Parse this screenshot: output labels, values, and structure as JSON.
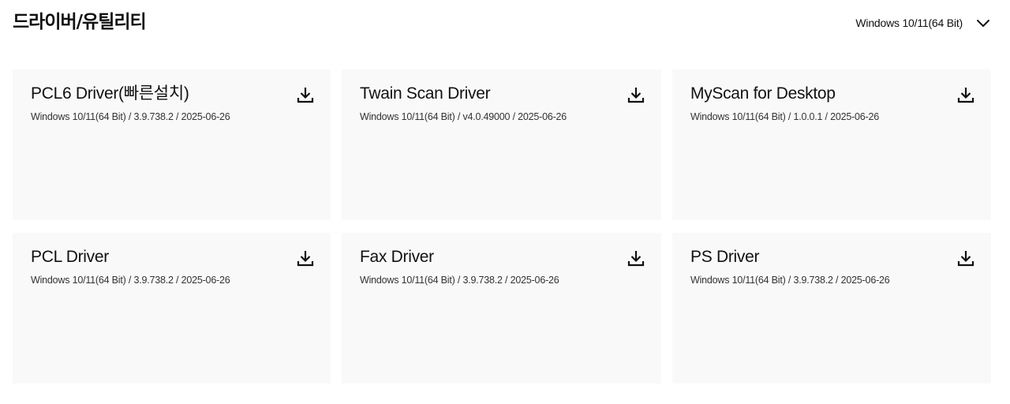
{
  "header": {
    "title": "드라이버/유틸리티",
    "os_selected": "Windows 10/11(64 Bit)",
    "os_icon": "chevron-down-icon"
  },
  "cards": [
    {
      "title": "PCL6 Driver(빠른설치)",
      "meta": "Windows 10/11(64 Bit) / 3.9.738.2 / 2025-06-26",
      "icon": "download-icon"
    },
    {
      "title": "Twain Scan Driver",
      "meta": "Windows 10/11(64 Bit) / v4.0.49000 / 2025-06-26",
      "icon": "download-icon"
    },
    {
      "title": "MyScan for Desktop",
      "meta": "Windows 10/11(64 Bit) / 1.0.0.1 / 2025-06-26",
      "icon": "download-icon"
    },
    {
      "title": "PCL Driver",
      "meta": "Windows 10/11(64 Bit) / 3.9.738.2 / 2025-06-26",
      "icon": "download-icon"
    },
    {
      "title": "Fax Driver",
      "meta": "Windows 10/11(64 Bit) / 3.9.738.2 / 2025-06-26",
      "icon": "download-icon"
    },
    {
      "title": "PS Driver",
      "meta": "Windows 10/11(64 Bit) / 3.9.738.2 / 2025-06-26",
      "icon": "download-icon"
    }
  ],
  "colors": {
    "card_background": "#f9f9f9",
    "text": "#111111"
  }
}
